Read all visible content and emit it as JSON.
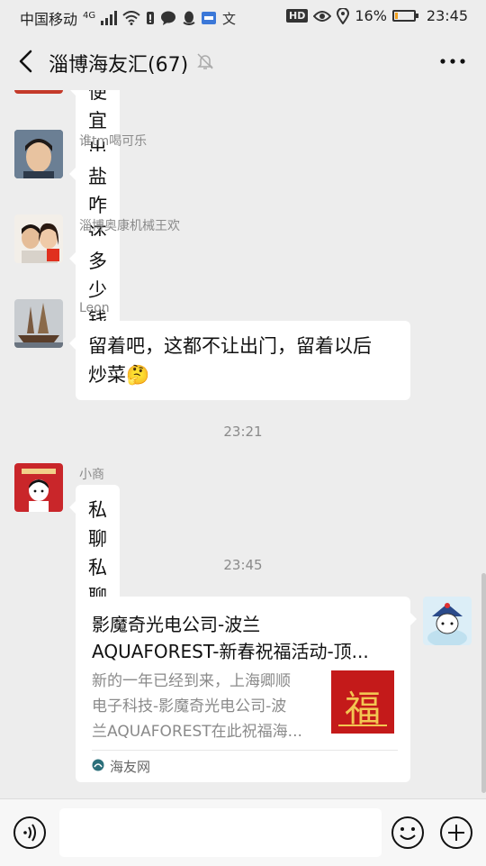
{
  "status_bar": {
    "carrier": "中国移动",
    "network": "4G",
    "battery_percent": "16%",
    "battery_level": 0.16,
    "time": "23:45",
    "icons": [
      "signal-icon",
      "wifi-icon",
      "alert-icon",
      "message-icon",
      "qq-icon",
      "app-icon",
      "translate-icon",
      "hd-icon",
      "eye-icon",
      "location-icon",
      "battery-icon"
    ]
  },
  "header": {
    "title": "淄博海友汇(67)",
    "muted": true
  },
  "messages": [
    {
      "type": "text",
      "sender": "",
      "text": "便宜出",
      "partial": true
    },
    {
      "type": "text",
      "sender": "谁tm喝可乐",
      "text": "盐咋还出了呢",
      "avatar": "avatar-boy"
    },
    {
      "type": "text",
      "sender": "淄博奥康机械王欢",
      "text": "多少钱",
      "avatar": "avatar-couple"
    },
    {
      "type": "text",
      "sender": "Leon",
      "text_line1": "留着吧，这都不让出门，留着以后",
      "text_line2": "炒菜🤔",
      "avatar": "avatar-ship"
    },
    {
      "type": "time",
      "text": "23:21"
    },
    {
      "type": "text",
      "sender": "小商",
      "text": "私聊私聊",
      "avatar": "avatar-cartoon"
    },
    {
      "type": "time",
      "text": "23:45"
    },
    {
      "type": "link_card",
      "self": true,
      "title_line1": "影魔奇光电公司-波兰",
      "title_line2": "AQUAFOREST-新春祝福活动-顶...",
      "desc_line1": "新的一年已经到来，上海卿顺",
      "desc_line2": "电子科技-影魔奇光电公司-波",
      "desc_line3": "兰AQUAFOREST在此祝福海...",
      "thumb_char": "福",
      "source": "海友网"
    }
  ],
  "input_bar": {
    "placeholder": ""
  },
  "colors": {
    "background": "#ededed",
    "bubble": "#ffffff",
    "thumb_red": "#c41a1a",
    "meta": "#8a8a8a"
  }
}
